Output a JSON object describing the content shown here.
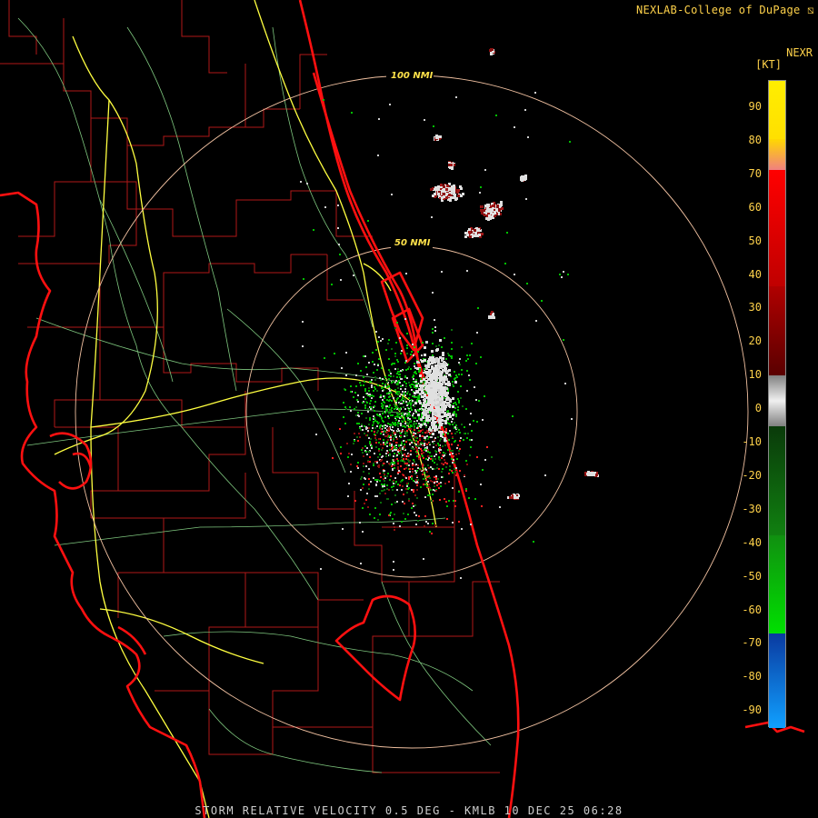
{
  "header": {
    "credit": "NEXLAB-College of DuPage ⧅"
  },
  "legend": {
    "product": "NEXR",
    "unit": "[KT]",
    "ticks": [
      "90",
      "80",
      "70",
      "60",
      "50",
      "40",
      "30",
      "20",
      "10",
      "0",
      "-10",
      "-20",
      "-30",
      "-40",
      "-50",
      "-60",
      "-70",
      "-80",
      "-90"
    ],
    "colors": {
      "high": "#ffee00",
      "orange": "#f0a040",
      "red": "#ff0000",
      "darkred": "#6a0000",
      "gray": "#d8d8d8",
      "darkgreen": "#0d5a0d",
      "green": "#00d000",
      "blue": "#1060ff",
      "lightblue": "#10a0ff"
    }
  },
  "rings": [
    {
      "label": "100 NMI"
    },
    {
      "label": "50 NMI"
    }
  ],
  "footer": {
    "caption": "STORM RELATIVE VELOCITY 0.5 DEG - KMLB 10 DEC 25 06:28"
  },
  "map_colors": {
    "coast": "#ff1010",
    "counties": "#b01818",
    "highways": "#ffff40",
    "roads": "#80c880",
    "rings": "#f0c0a0"
  }
}
